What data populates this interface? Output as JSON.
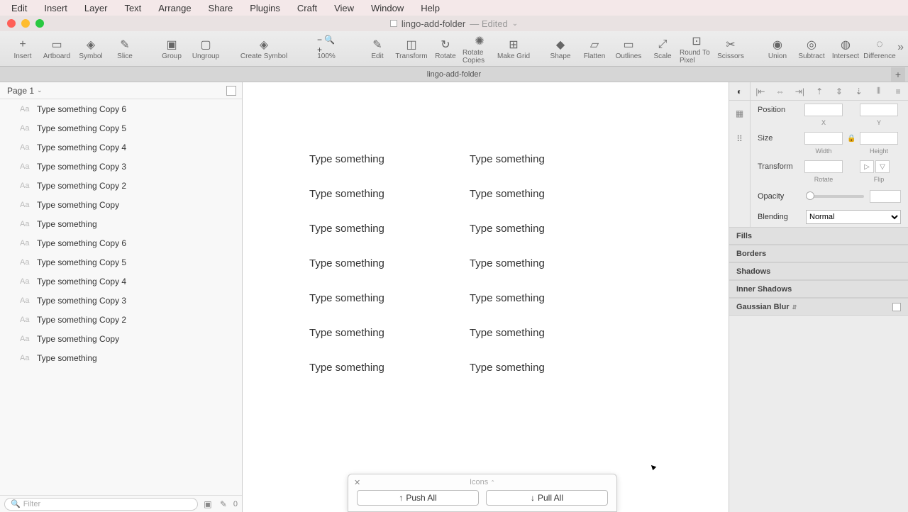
{
  "menubar": [
    "Edit",
    "Insert",
    "Layer",
    "Text",
    "Arrange",
    "Share",
    "Plugins",
    "Craft",
    "View",
    "Window",
    "Help"
  ],
  "title": {
    "name": "lingo-add-folder",
    "edited": "— Edited"
  },
  "toolbar": [
    {
      "label": "Insert",
      "icon": "+"
    },
    {
      "label": "Artboard",
      "icon": "▭"
    },
    {
      "label": "Symbol",
      "icon": "◈"
    },
    {
      "label": "Slice",
      "icon": "✎"
    },
    {
      "label": "Group",
      "icon": "▣"
    },
    {
      "label": "Ungroup",
      "icon": "▢"
    },
    {
      "label": "Create Symbol",
      "icon": "◈",
      "wide": true
    },
    {
      "label": "100%",
      "icon": "− 🔍 +",
      "zoom": true
    },
    {
      "label": "Edit",
      "icon": "✎"
    },
    {
      "label": "Transform",
      "icon": "◫"
    },
    {
      "label": "Rotate",
      "icon": "↻"
    },
    {
      "label": "Rotate Copies",
      "icon": "✺"
    },
    {
      "label": "Make Grid",
      "icon": "⊞"
    },
    {
      "label": "Shape",
      "icon": "◆"
    },
    {
      "label": "Flatten",
      "icon": "▱"
    },
    {
      "label": "Outlines",
      "icon": "▭"
    },
    {
      "label": "Scale",
      "icon": "⤢"
    },
    {
      "label": "Round To Pixel",
      "icon": "⊡"
    },
    {
      "label": "Scissors",
      "icon": "✂"
    },
    {
      "label": "Union",
      "icon": "◉"
    },
    {
      "label": "Subtract",
      "icon": "◎"
    },
    {
      "label": "Intersect",
      "icon": "◍"
    },
    {
      "label": "Difference",
      "icon": "◌"
    }
  ],
  "tab": "lingo-add-folder",
  "page": "Page 1",
  "layers": [
    "Type something Copy 6",
    "Type something Copy 5",
    "Type something Copy 4",
    "Type something Copy 3",
    "Type something Copy 2",
    "Type something Copy",
    "Type something",
    "Type something Copy 6",
    "Type something Copy 5",
    "Type something Copy 4",
    "Type something Copy 3",
    "Type something Copy 2",
    "Type something Copy",
    "Type something"
  ],
  "filter_placeholder": "Filter",
  "slice_count": "0",
  "canvas_text": "Type something",
  "popup": {
    "title": "Icons",
    "push": "Push All",
    "pull": "Pull All"
  },
  "inspector": {
    "position": "Position",
    "x": "X",
    "y": "Y",
    "size": "Size",
    "width": "Width",
    "height": "Height",
    "transform": "Transform",
    "rotate": "Rotate",
    "flip": "Flip",
    "opacity": "Opacity",
    "blending": "Blending",
    "blend_value": "Normal",
    "sections": [
      "Fills",
      "Borders",
      "Shadows",
      "Inner Shadows"
    ],
    "blur": "Gaussian Blur"
  }
}
